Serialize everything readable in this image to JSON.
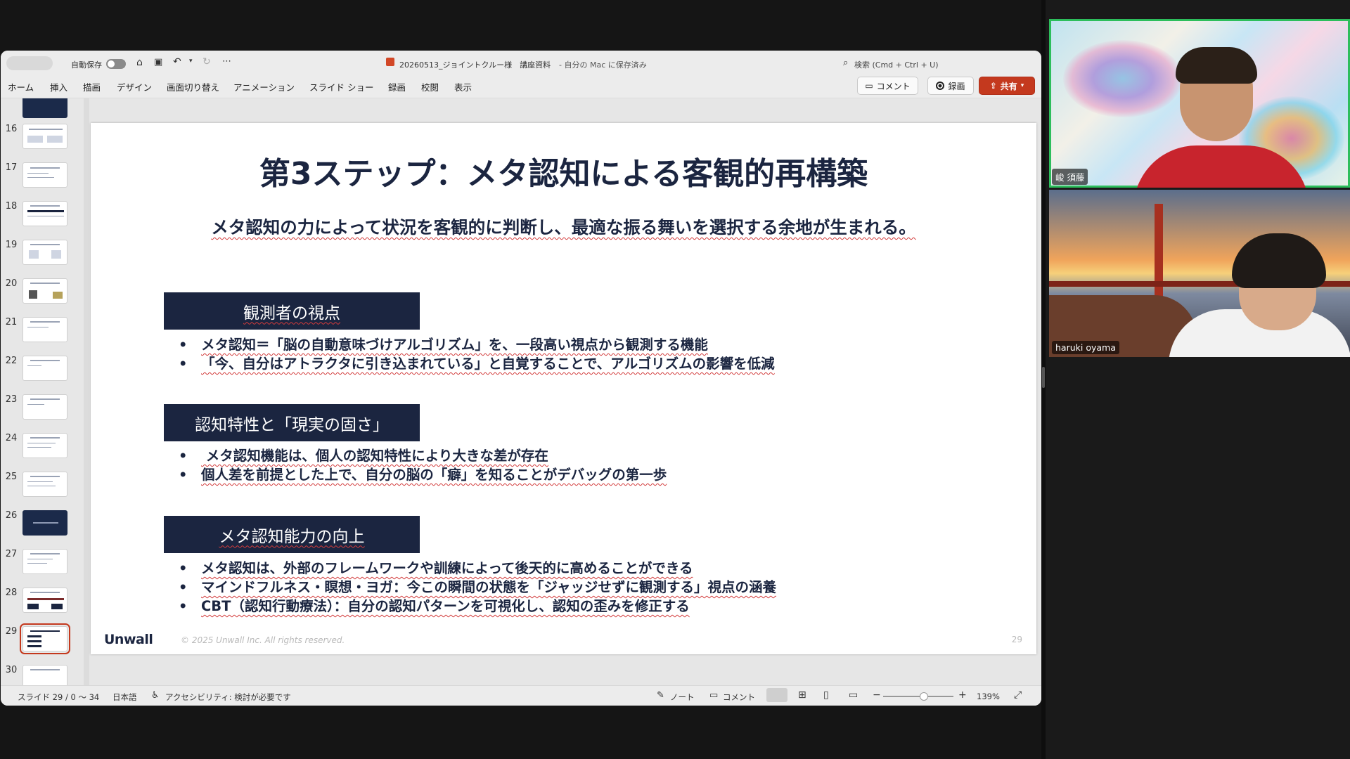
{
  "window": {
    "autosave_label": "自動保存",
    "filename": "20260513_ジョイントクルー様　講座資料",
    "save_status": "- 自分の Mac に保存済み",
    "search_placeholder": "検索 (Cmd + Ctrl + U)"
  },
  "menu": [
    "ホーム",
    "挿入",
    "描画",
    "デザイン",
    "画面切り替え",
    "アニメーション",
    "スライド ショー",
    "録画",
    "校閲",
    "表示"
  ],
  "actions": {
    "comment": "コメント",
    "record": "録画",
    "share": "共有"
  },
  "thumbnails": [
    {
      "num": "16"
    },
    {
      "num": "17"
    },
    {
      "num": "18"
    },
    {
      "num": "19"
    },
    {
      "num": "20"
    },
    {
      "num": "21"
    },
    {
      "num": "22"
    },
    {
      "num": "23"
    },
    {
      "num": "24"
    },
    {
      "num": "25"
    },
    {
      "num": "26"
    },
    {
      "num": "27"
    },
    {
      "num": "28"
    },
    {
      "num": "29"
    },
    {
      "num": "30"
    }
  ],
  "slide": {
    "title": "第3ステップ：メタ認知による客観的再構築",
    "subtitle": "メタ認知の力によって状況を客観的に判断し、最適な振る舞いを選択する余地が生まれる。",
    "sections": [
      {
        "heading": "観測者の視点",
        "bullets": [
          "メタ認知＝「脳の自動意味づけアルゴリズム」を、一段高い視点から観測する機能",
          "「今、自分はアトラクタに引き込まれている」と自覚することで、アルゴリズムの影響を低減"
        ]
      },
      {
        "heading": "認知特性と「現実の固さ」",
        "bullets": [
          " メタ認知機能は、個人の認知特性により大きな差が存在",
          "個人差を前提とした上で、自分の脳の「癖」を知ることがデバッグの第一歩"
        ]
      },
      {
        "heading": "メタ認知能力の向上",
        "bullets": [
          "メタ認知は、外部のフレームワークや訓練によって後天的に高めることができる",
          "マインドフルネス・瞑想・ヨガ：今この瞬間の状態を「ジャッジせずに観測する」視点の涵養",
          "CBT（認知行動療法）：自分の認知パターンを可視化し、認知の歪みを修正する"
        ]
      }
    ],
    "logo": "Unwall",
    "copyright": "© 2025 Unwall Inc. All rights reserved.",
    "page_number": "29"
  },
  "statusbar": {
    "slide_info": "スライド 29 / 0 〜 34",
    "language": "日本語",
    "accessibility": "アクセシビリティ: 検討が必要です",
    "notes": "ノート",
    "comments": "コメント",
    "zoom": "139%"
  },
  "participants": [
    {
      "name": "峻 須藤"
    },
    {
      "name": "haruki oyama"
    }
  ],
  "colors": {
    "accent": "#c4391e",
    "slide_navy": "#1b2540",
    "active_speaker": "#2dbe5c"
  }
}
